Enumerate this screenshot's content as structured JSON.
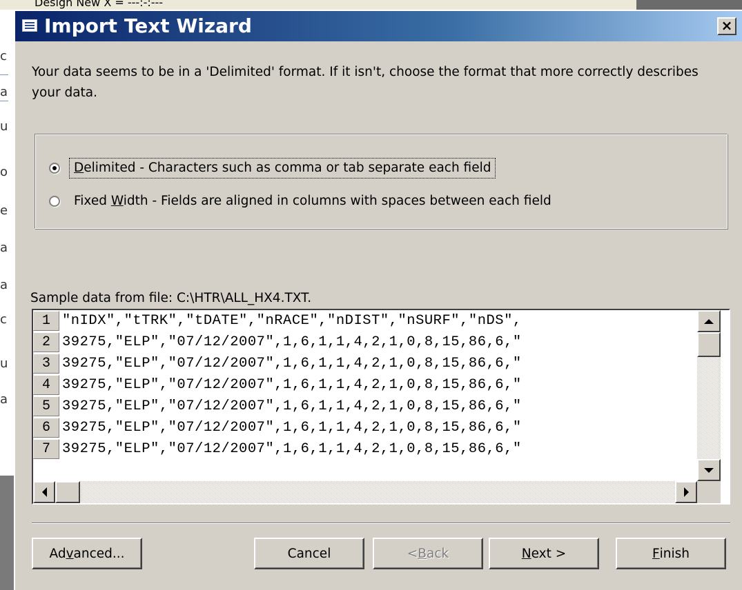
{
  "background": {
    "toolbar_text": "Design   New   X   =   ---:-:---",
    "left_fragments": [
      "c",
      "a",
      "u",
      "o",
      "e",
      "a",
      "a",
      "c",
      "u",
      "a"
    ]
  },
  "dialog": {
    "title": "Import Text Wizard",
    "close_label": "×",
    "intro_text": "Your data seems to be in a 'Delimited' format. If it isn't, choose the format that more correctly describes your data.",
    "format_options": [
      {
        "mnemonic": "D",
        "label_rest": "elimited - Characters such as comma or tab separate each field",
        "selected": true
      },
      {
        "label_before": "Fixed ",
        "mnemonic": "W",
        "label_rest": "idth - Fields are aligned in columns with spaces between each field",
        "selected": false
      }
    ],
    "sample_label": "Sample data from file: C:\\HTR\\ALL_HX4.TXT.",
    "sample_rows": [
      {
        "num": "1",
        "text": "\"nIDX\",\"tTRK\",\"tDATE\",\"nRACE\",\"nDIST\",\"nSURF\",\"nDS\","
      },
      {
        "num": "2",
        "text": "39275,\"ELP\",\"07/12/2007\",1,6,1,1,4,2,1,0,8,15,86,6,\""
      },
      {
        "num": "3",
        "text": "39275,\"ELP\",\"07/12/2007\",1,6,1,1,4,2,1,0,8,15,86,6,\""
      },
      {
        "num": "4",
        "text": "39275,\"ELP\",\"07/12/2007\",1,6,1,1,4,2,1,0,8,15,86,6,\""
      },
      {
        "num": "5",
        "text": "39275,\"ELP\",\"07/12/2007\",1,6,1,1,4,2,1,0,8,15,86,6,\""
      },
      {
        "num": "6",
        "text": "39275,\"ELP\",\"07/12/2007\",1,6,1,1,4,2,1,0,8,15,86,6,\""
      },
      {
        "num": "7",
        "text": "39275,\"ELP\",\"07/12/2007\",1,6,1,1,4,2,1,0,8,15,86,6,\""
      }
    ],
    "buttons": {
      "advanced": {
        "before": "Ad",
        "mnemonic": "v",
        "after": "anced..."
      },
      "cancel": {
        "label": "Cancel"
      },
      "back": {
        "before": "< ",
        "mnemonic": "B",
        "after": "ack",
        "enabled": false
      },
      "next": {
        "before": "",
        "mnemonic": "N",
        "after": "ext >"
      },
      "finish": {
        "before": "",
        "mnemonic": "F",
        "after": "inish"
      }
    }
  },
  "colors": {
    "title_gradient_start": "#0a246a",
    "title_gradient_end": "#a6caf0",
    "dialog_face": "#d4d0c8"
  }
}
